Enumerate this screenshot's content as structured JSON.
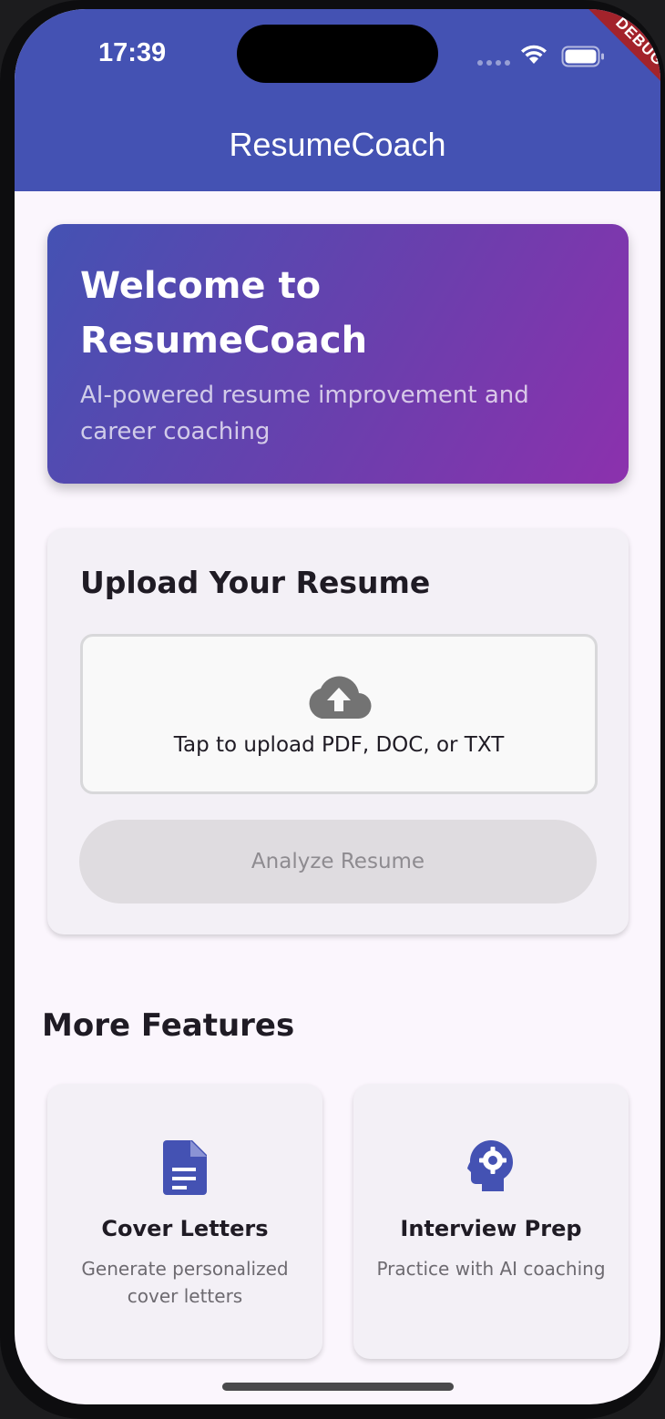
{
  "status_bar": {
    "time": "17:39",
    "debug_label": "DEBUG"
  },
  "app_bar": {
    "title": "ResumeCoach",
    "color": "#4452b3"
  },
  "welcome": {
    "title": "Welcome to ResumeCoach",
    "subtitle": "AI-powered resume improvement and career coaching"
  },
  "upload": {
    "title": "Upload Your Resume",
    "icon": "cloud-upload-icon",
    "prompt": "Tap to upload PDF, DOC, or TXT",
    "analyze_label": "Analyze Resume"
  },
  "features": {
    "title": "More Features",
    "items": [
      {
        "icon": "document-icon",
        "title": "Cover Letters",
        "description": "Generate personalized cover letters"
      },
      {
        "icon": "psychology-icon",
        "title": "Interview Prep",
        "description": "Practice with AI coaching"
      }
    ]
  }
}
